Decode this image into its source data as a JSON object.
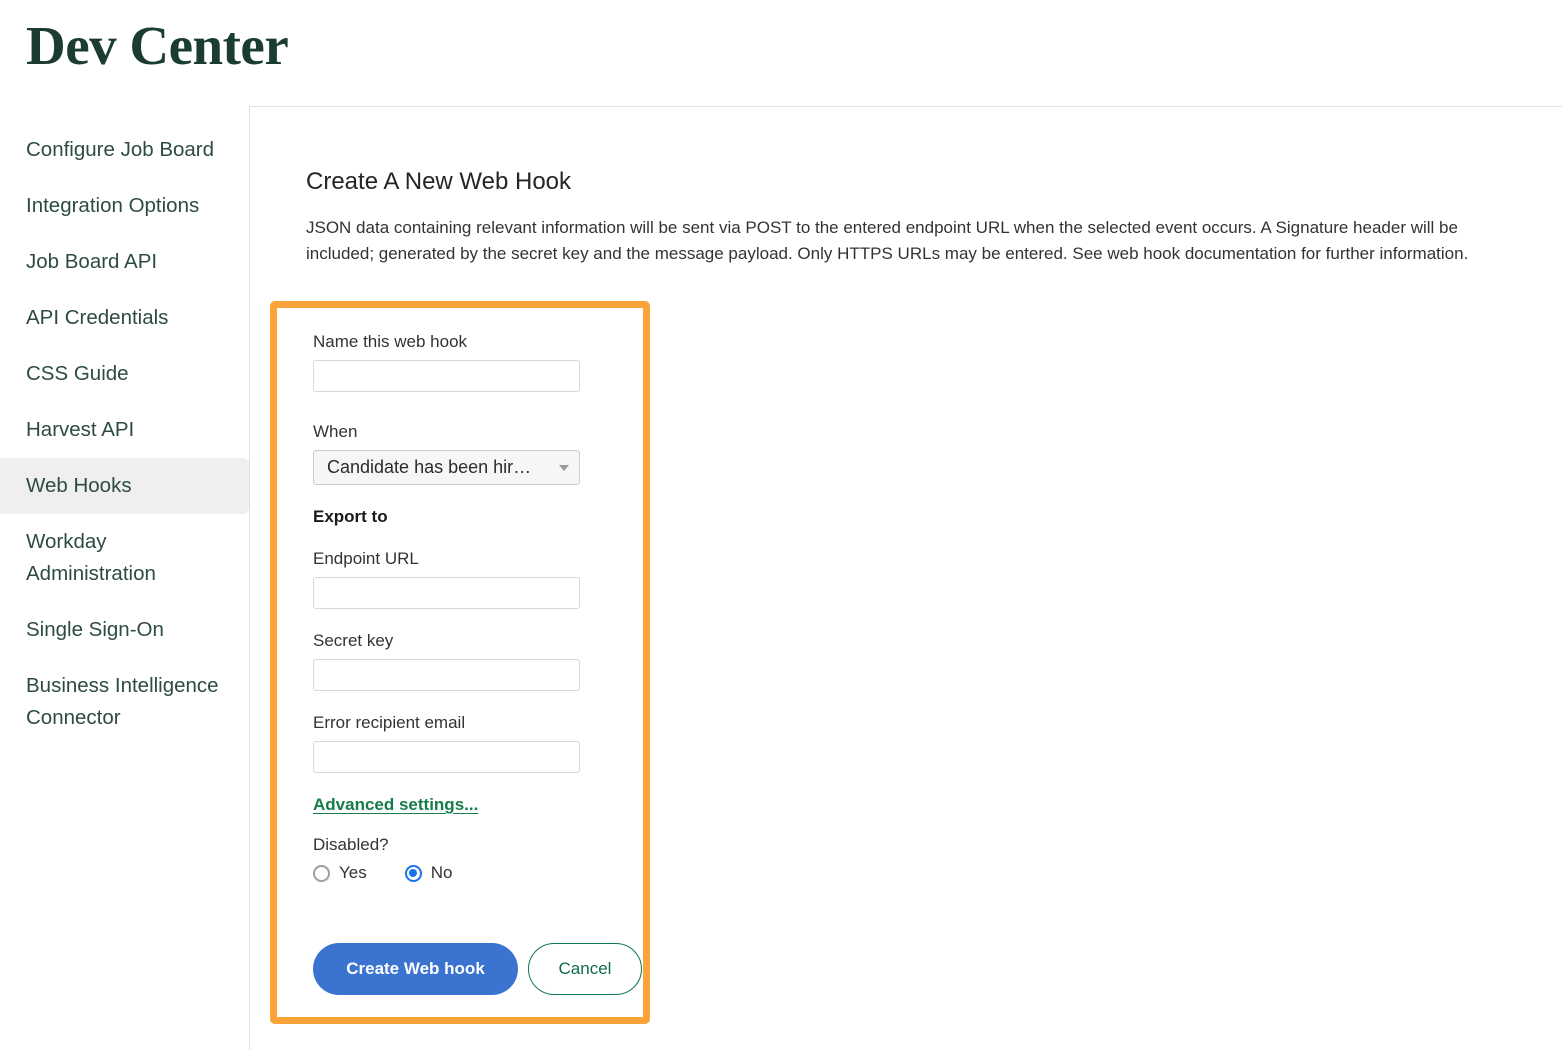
{
  "header": {
    "title": "Dev Center"
  },
  "sidebar": {
    "items": [
      {
        "label": "Configure Job Board",
        "active": false
      },
      {
        "label": "Integration Options",
        "active": false
      },
      {
        "label": "Job Board API",
        "active": false
      },
      {
        "label": "API Credentials",
        "active": false
      },
      {
        "label": "CSS Guide",
        "active": false
      },
      {
        "label": "Harvest API",
        "active": false
      },
      {
        "label": "Web Hooks",
        "active": true
      },
      {
        "label": "Workday Administration",
        "active": false
      },
      {
        "label": "Single Sign-On",
        "active": false
      },
      {
        "label": "Business Intelligence Connector",
        "active": false
      }
    ]
  },
  "main": {
    "section_title": "Create A New Web Hook",
    "section_description": "JSON data containing relevant information will be sent via POST to the entered endpoint URL when the selected event occurs. A Signature header will be included; generated by the secret key and the message payload. Only HTTPS URLs may be entered. See web hook documentation for further information."
  },
  "form": {
    "highlight_color": "#f9a33a",
    "name_label": "Name this web hook",
    "name_value": "",
    "name_placeholder": "",
    "when_label": "When",
    "when_selected": "Candidate has been hir…",
    "when_options": [
      "Candidate has been hir…"
    ],
    "export_to_label": "Export to",
    "endpoint_label": "Endpoint URL",
    "endpoint_value": "",
    "endpoint_placeholder": "",
    "secret_label": "Secret key",
    "secret_value": "",
    "secret_placeholder": "",
    "error_email_label": "Error recipient email",
    "error_email_value": "",
    "error_email_placeholder": "",
    "advanced_settings_label": "Advanced settings...",
    "disabled_label": "Disabled?",
    "disabled_options": [
      {
        "label": "Yes",
        "selected": false
      },
      {
        "label": "No",
        "selected": true
      }
    ],
    "submit_label": "Create Web hook",
    "cancel_label": "Cancel",
    "submit_color": "#3b73d0",
    "cancel_color": "#0f7a4c"
  }
}
